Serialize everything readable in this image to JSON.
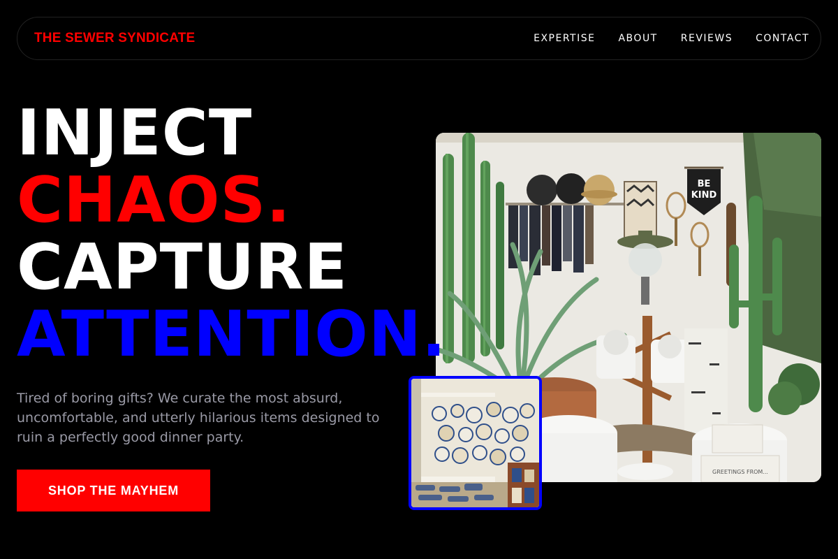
{
  "nav": {
    "brand": "THE SEWER SYNDICATE",
    "links": [
      "EXPERTISE",
      "ABOUT",
      "REVIEWS",
      "CONTACT"
    ]
  },
  "hero": {
    "headline": [
      "INJECT",
      "CHAOS.",
      "CAPTURE",
      "ATTENTION."
    ],
    "description": "Tired of boring gifts? We curate the most absurd, uncomfortable, and utterly hilarious items designed to ruin a perfectly good dinner party.",
    "cta_label": "SHOP THE MAYHEM"
  },
  "images": {
    "main": {
      "subject": "shop interior with cacti, hats and mugs",
      "banner_text": [
        "BE",
        "KIND"
      ],
      "card_text": "GREETINGS FROM..."
    },
    "inset": {
      "subject": "shelves of decorative ceramic plates"
    }
  },
  "colors": {
    "background": "#000000",
    "accent_red": "#ff0000",
    "accent_blue": "#0000ff",
    "text_white": "#ffffff",
    "text_muted": "#9a9aa6"
  }
}
